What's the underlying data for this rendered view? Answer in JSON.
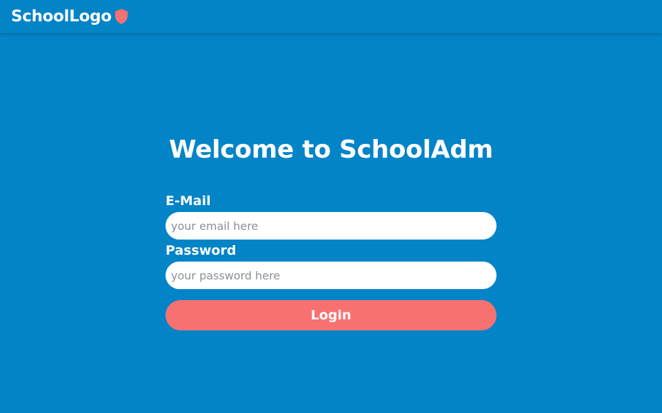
{
  "header": {
    "logo_text": "SchoolLogo",
    "logo_icon": "shield-icon"
  },
  "main": {
    "welcome_title": "Welcome to SchoolAdm"
  },
  "login_form": {
    "email_label": "E-Mail",
    "email_placeholder": "your email here",
    "email_value": "",
    "password_label": "Password",
    "password_placeholder": "your password here",
    "password_value": "",
    "login_button_label": "Login"
  },
  "colors": {
    "background": "#0284c7",
    "accent": "#f87171",
    "input_background": "#ffffff",
    "text": "#ffffff"
  }
}
